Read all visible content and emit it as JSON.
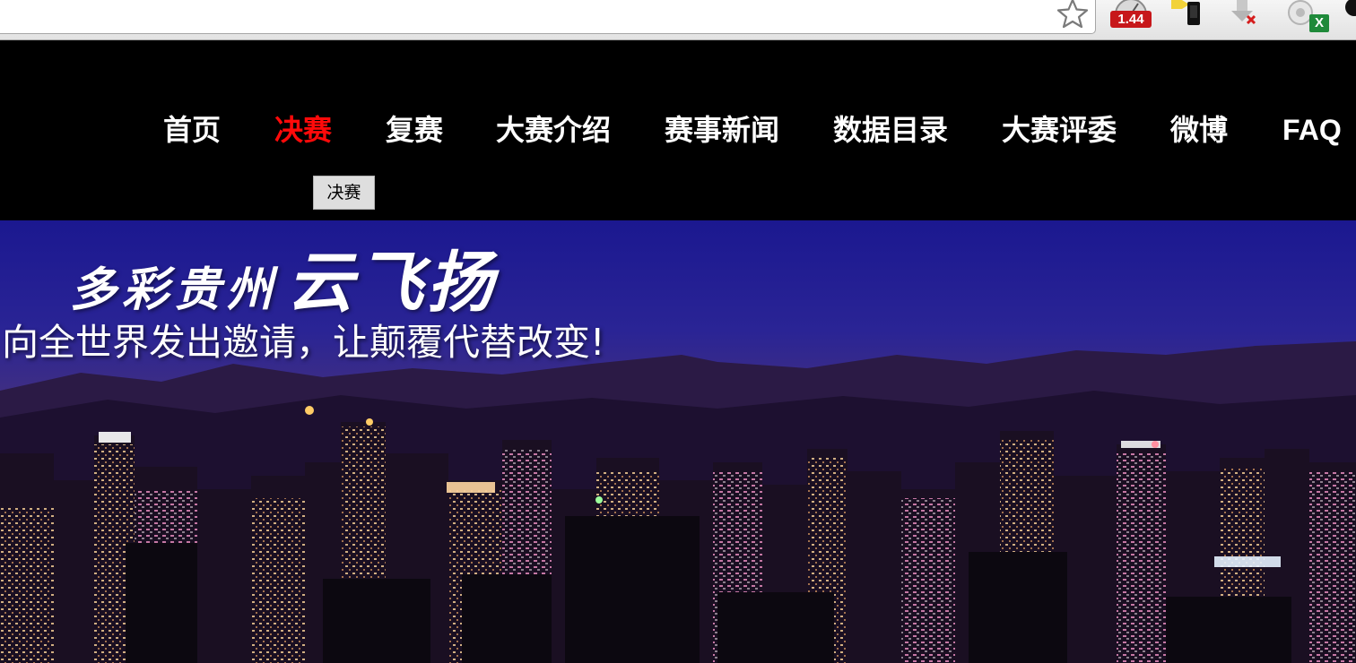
{
  "browser": {
    "speed_badge": "1.44",
    "excel_badge": "X",
    "icons": [
      "star-icon",
      "speed-icon",
      "phone-icon",
      "download-icon",
      "excel-icon"
    ]
  },
  "nav": {
    "items": [
      {
        "label": "首页",
        "active": false
      },
      {
        "label": "决赛",
        "active": true
      },
      {
        "label": "复赛",
        "active": false
      },
      {
        "label": "大赛介绍",
        "active": false
      },
      {
        "label": "赛事新闻",
        "active": false
      },
      {
        "label": "数据目录",
        "active": false
      },
      {
        "label": "大赛评委",
        "active": false
      },
      {
        "label": "微博",
        "active": false
      },
      {
        "label": "FAQ",
        "active": false
      }
    ],
    "tooltip": "决赛"
  },
  "hero": {
    "title_part_a": "多彩贵州",
    "title_part_b": "云飞扬",
    "slogan": "向全世界发出邀请，让颠覆代替改变!"
  },
  "colors": {
    "nav_active": "#ff0a0a",
    "nav_text": "#ffffff",
    "header_bg": "#000000"
  }
}
